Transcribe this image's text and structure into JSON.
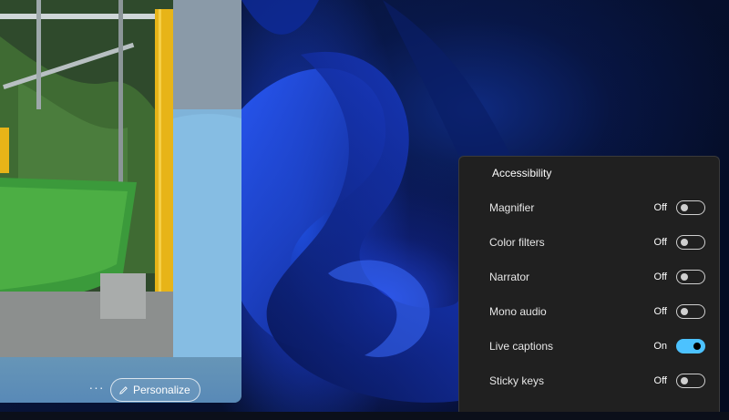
{
  "widget": {
    "more_label": "···",
    "personalize_label": "Personalize"
  },
  "accessibility": {
    "title": "Accessibility",
    "settings": [
      {
        "label": "Magnifier",
        "state": "Off",
        "on": false
      },
      {
        "label": "Color filters",
        "state": "Off",
        "on": false
      },
      {
        "label": "Narrator",
        "state": "Off",
        "on": false
      },
      {
        "label": "Mono audio",
        "state": "Off",
        "on": false
      },
      {
        "label": "Live captions",
        "state": "On",
        "on": true
      },
      {
        "label": "Sticky keys",
        "state": "Off",
        "on": false
      }
    ],
    "colors": {
      "panel_bg": "#202020",
      "toggle_on": "#4cc2ff"
    }
  },
  "icons": {
    "edit": "pencil-icon",
    "more": "more-icon"
  }
}
